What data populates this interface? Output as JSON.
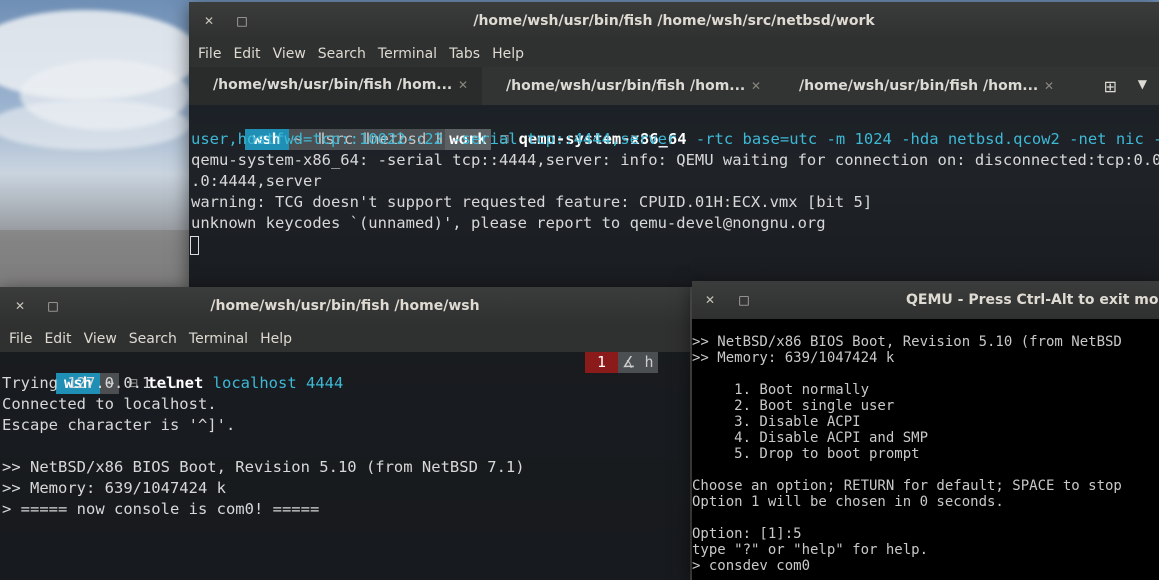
{
  "windows": {
    "fish_main": {
      "title": "/home/wsh/usr/bin/fish  /home/wsh/src/netbsd/work",
      "menu": [
        "File",
        "Edit",
        "View",
        "Search",
        "Terminal",
        "Tabs",
        "Help"
      ],
      "tabs": [
        {
          "label": "/home/wsh/usr/bin/fish  /hom...",
          "active": true
        },
        {
          "label": "/home/wsh/usr/bin/fish  /hom...",
          "active": false
        },
        {
          "label": "/home/wsh/usr/bin/fish  /hom...",
          "active": false
        }
      ],
      "prompt": {
        "user": "wsh",
        "home": "~",
        "p1": "src",
        "p2": "netbsd",
        "p3": "work"
      },
      "command": "qemu-system-x86_64",
      "args_line1": " -rtc base=utc -m 1024 -hda netbsd.qcow2 -net nic -net",
      "args_line2": "user,hostfwd=tcp::10022-:22 -serial tcp::4444,server",
      "output": [
        "qemu-system-x86_64: -serial tcp::4444,server: info: QEMU waiting for connection on: disconnected:tcp:0.0.0",
        ".0:4444,server",
        "warning: TCG doesn't support requested feature: CPUID.01H:ECX.vmx [bit 5]",
        "unknown keycodes `(unnamed)', please report to qemu-devel@nongnu.org"
      ]
    },
    "fish_small": {
      "title": "/home/wsh/usr/bin/fish  /home/wsh",
      "menu": [
        "File",
        "Edit",
        "View",
        "Search",
        "Terminal",
        "Help"
      ],
      "prompt": {
        "user": "wsh",
        "home": "~"
      },
      "command": "telnet",
      "args": " localhost 4444",
      "status_code": "1",
      "right_hint": "h",
      "output": [
        "Trying 127.0.0.1...",
        "Connected to localhost.",
        "Escape character is '^]'.",
        "",
        ">> NetBSD/x86 BIOS Boot, Revision 5.10 (from NetBSD 7.1)",
        ">> Memory: 639/1047424 k",
        "> ===== now console is com0! ====="
      ]
    },
    "qemu": {
      "title": "QEMU - Press Ctrl-Alt to exit mouse",
      "lines": [
        ">> NetBSD/x86 BIOS Boot, Revision 5.10 (from NetBSD",
        ">> Memory: 639/1047424 k",
        "",
        "     1. Boot normally",
        "     2. Boot single user",
        "     3. Disable ACPI",
        "     4. Disable ACPI and SMP",
        "     5. Drop to boot prompt",
        "",
        "Choose an option; RETURN for default; SPACE to stop",
        "Option 1 will be chosen in 0 seconds.",
        "",
        "Option: [1]:5",
        "type \"?\" or \"help\" for help.",
        "> consdev com0"
      ]
    }
  },
  "colors": {
    "cyan": "#3db9d6",
    "prompt_bg": "#4b4f52",
    "user_bg": "#1f8fb6",
    "error_bg": "#8b1a1a"
  },
  "icons": {
    "close": "close-icon",
    "maximize": "maximize-icon",
    "new_tab": "new-tab-icon",
    "tab_menu": "chevron-down-icon"
  }
}
